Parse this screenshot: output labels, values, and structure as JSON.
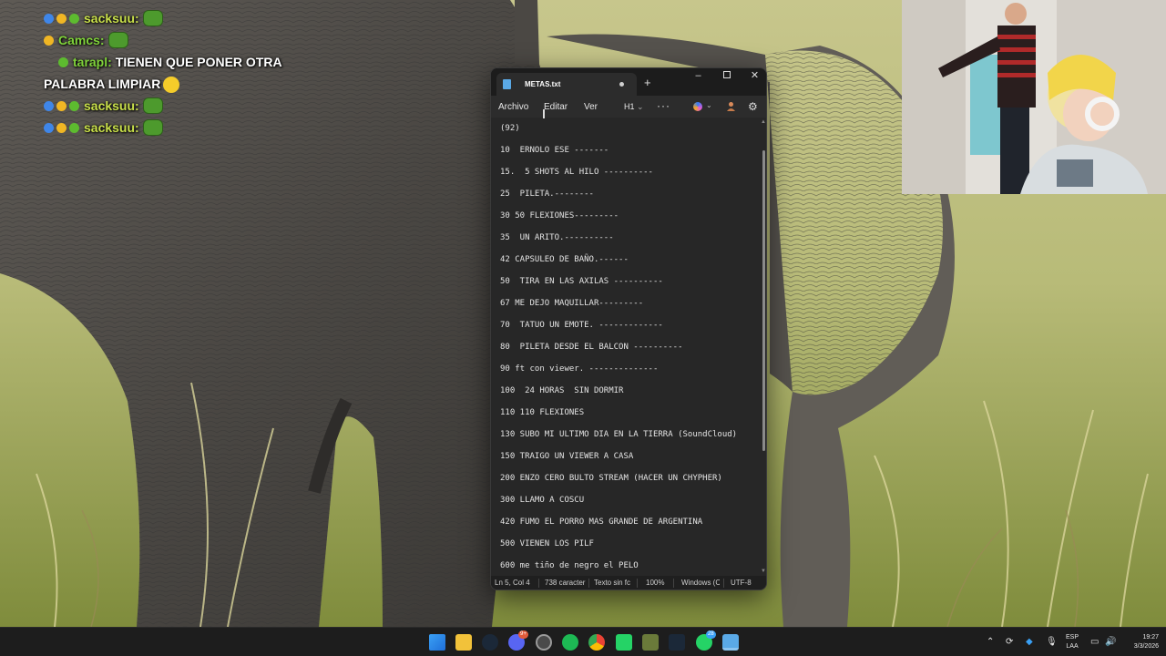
{
  "chat": {
    "lines": [
      {
        "user": "sacksuu:",
        "message": ""
      },
      {
        "user": "Camcs:",
        "message": ""
      },
      {
        "user": "tarapl:",
        "message": "TIENEN QUE PONER OTRA"
      },
      {
        "wrap": "PALABRA LIMPIAR"
      },
      {
        "user": "sacksuu:",
        "message": ""
      },
      {
        "user": "sacksuu:",
        "message": ""
      }
    ]
  },
  "notepad": {
    "tab_title": "METAS.txt",
    "new_tab": "+",
    "window_controls": {
      "minimize": "–",
      "maximize": "",
      "close": "✕"
    },
    "menu": {
      "archivo": "Archivo",
      "editar": "Editar",
      "ver": "Ver",
      "heading": "H1",
      "more": "···"
    },
    "lines": [
      "(92)",
      "10  ERNOLO ESE -------",
      "15.  5 SHOTS AL HILO ----------",
      "25  PILETA.--------",
      "30 50 FLEXIONES---------",
      "35  UN ARITO.----------",
      "42 CAPSULEO DE BAÑO.------",
      "50  TIRA EN LAS AXILAS ----------",
      "67 ME DEJO MAQUILLAR---------",
      "70  TATUO UN EMOTE. -------------",
      "80  PILETA DESDE EL BALCON ----------",
      "90 ft con viewer. --------------",
      "100  24 HORAS  SIN DORMIR",
      "110 110 FLEXIONES",
      "130 SUBO MI ULTIMO DIA EN LA TIERRA (SoundCloud)",
      "150 TRAIGO UN VIEWER A CASA",
      "200 ENZO CERO BULTO STREAM (HACER UN CHYPHER)",
      "300 LLAMO A COSCU",
      "420 FUMO EL PORRO MAS GRANDE DE ARGENTINA",
      "500 VIENEN LOS PILF",
      "600 me tiño de negro el PELO"
    ],
    "status": {
      "position": "Ln 5, Col 4",
      "chars": "738 caracter",
      "format": "Texto sin fc",
      "zoom": "100%",
      "line_ending": "Windows (C",
      "encoding": "UTF-8"
    }
  },
  "taskbar": {
    "discord_badge": "9+",
    "whatsapp_badge": "28",
    "lang_top": "ESP",
    "lang_bottom": "LAA",
    "time": "19:27",
    "date": "3/3/2026"
  },
  "colors": {
    "editor_bg": "#272727",
    "titlebar_bg": "#1c1c1c",
    "taskbar_bg": "#1d1d1d",
    "chat_user_green": "#7fd23a"
  }
}
